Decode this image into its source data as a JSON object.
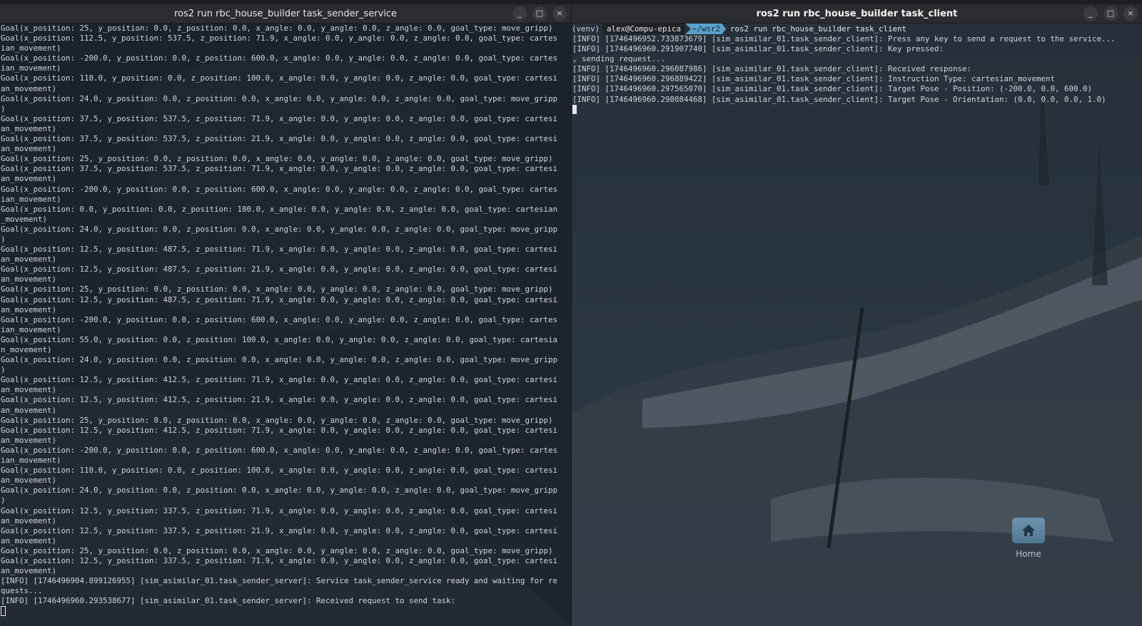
{
  "left_window": {
    "title": "ros2 run rbc_house_builder task_sender_service",
    "lines": [
      "Goal(x_position: 25, y_position: 0.0, z_position: 0.0, x_angle: 0.0, y_angle: 0.0, z_angle: 0.0, goal_type: move_gripp)",
      "Goal(x_position: 112.5, y_position: 537.5, z_position: 71.9, x_angle: 0.0, y_angle: 0.0, z_angle: 0.0, goal_type: cartes",
      "ian_movement)",
      "Goal(x_position: -200.0, y_position: 0.0, z_position: 600.0, x_angle: 0.0, y_angle: 0.0, z_angle: 0.0, goal_type: cartes",
      "ian_movement)",
      "Goal(x_position: 110.0, y_position: 0.0, z_position: 100.0, x_angle: 0.0, y_angle: 0.0, z_angle: 0.0, goal_type: cartesi",
      "an_movement)",
      "Goal(x_position: 24.0, y_position: 0.0, z_position: 0.0, x_angle: 0.0, y_angle: 0.0, z_angle: 0.0, goal_type: move_gripp",
      ")",
      "Goal(x_position: 37.5, y_position: 537.5, z_position: 71.9, x_angle: 0.0, y_angle: 0.0, z_angle: 0.0, goal_type: cartesi",
      "an_movement)",
      "Goal(x_position: 37.5, y_position: 537.5, z_position: 21.9, x_angle: 0.0, y_angle: 0.0, z_angle: 0.0, goal_type: cartesi",
      "an_movement)",
      "Goal(x_position: 25, y_position: 0.0, z_position: 0.0, x_angle: 0.0, y_angle: 0.0, z_angle: 0.0, goal_type: move_gripp)",
      "Goal(x_position: 37.5, y_position: 537.5, z_position: 71.9, x_angle: 0.0, y_angle: 0.0, z_angle: 0.0, goal_type: cartesi",
      "an_movement)",
      "Goal(x_position: -200.0, y_position: 0.0, z_position: 600.0, x_angle: 0.0, y_angle: 0.0, z_angle: 0.0, goal_type: cartes",
      "ian_movement)",
      "Goal(x_position: 0.0, y_position: 0.0, z_position: 100.0, x_angle: 0.0, y_angle: 0.0, z_angle: 0.0, goal_type: cartesian",
      "_movement)",
      "Goal(x_position: 24.0, y_position: 0.0, z_position: 0.0, x_angle: 0.0, y_angle: 0.0, z_angle: 0.0, goal_type: move_gripp",
      ")",
      "Goal(x_position: 12.5, y_position: 487.5, z_position: 71.9, x_angle: 0.0, y_angle: 0.0, z_angle: 0.0, goal_type: cartesi",
      "an_movement)",
      "Goal(x_position: 12.5, y_position: 487.5, z_position: 21.9, x_angle: 0.0, y_angle: 0.0, z_angle: 0.0, goal_type: cartesi",
      "an_movement)",
      "Goal(x_position: 25, y_position: 0.0, z_position: 0.0, x_angle: 0.0, y_angle: 0.0, z_angle: 0.0, goal_type: move_gripp)",
      "Goal(x_position: 12.5, y_position: 487.5, z_position: 71.9, x_angle: 0.0, y_angle: 0.0, z_angle: 0.0, goal_type: cartesi",
      "an_movement)",
      "Goal(x_position: -200.0, y_position: 0.0, z_position: 600.0, x_angle: 0.0, y_angle: 0.0, z_angle: 0.0, goal_type: cartes",
      "ian_movement)",
      "Goal(x_position: 55.0, y_position: 0.0, z_position: 100.0, x_angle: 0.0, y_angle: 0.0, z_angle: 0.0, goal_type: cartesia",
      "n_movement)",
      "Goal(x_position: 24.0, y_position: 0.0, z_position: 0.0, x_angle: 0.0, y_angle: 0.0, z_angle: 0.0, goal_type: move_gripp",
      ")",
      "Goal(x_position: 12.5, y_position: 412.5, z_position: 71.9, x_angle: 0.0, y_angle: 0.0, z_angle: 0.0, goal_type: cartesi",
      "an_movement)",
      "Goal(x_position: 12.5, y_position: 412.5, z_position: 21.9, x_angle: 0.0, y_angle: 0.0, z_angle: 0.0, goal_type: cartesi",
      "an_movement)",
      "Goal(x_position: 25, y_position: 0.0, z_position: 0.0, x_angle: 0.0, y_angle: 0.0, z_angle: 0.0, goal_type: move_gripp)",
      "Goal(x_position: 12.5, y_position: 412.5, z_position: 71.9, x_angle: 0.0, y_angle: 0.0, z_angle: 0.0, goal_type: cartesi",
      "an_movement)",
      "Goal(x_position: -200.0, y_position: 0.0, z_position: 600.0, x_angle: 0.0, y_angle: 0.0, z_angle: 0.0, goal_type: cartes",
      "ian_movement)",
      "Goal(x_position: 110.0, y_position: 0.0, z_position: 100.0, x_angle: 0.0, y_angle: 0.0, z_angle: 0.0, goal_type: cartesi",
      "an_movement)",
      "Goal(x_position: 24.0, y_position: 0.0, z_position: 0.0, x_angle: 0.0, y_angle: 0.0, z_angle: 0.0, goal_type: move_gripp",
      ")",
      "Goal(x_position: 12.5, y_position: 337.5, z_position: 71.9, x_angle: 0.0, y_angle: 0.0, z_angle: 0.0, goal_type: cartesi",
      "an_movement)",
      "Goal(x_position: 12.5, y_position: 337.5, z_position: 21.9, x_angle: 0.0, y_angle: 0.0, z_angle: 0.0, goal_type: cartesi",
      "an_movement)",
      "Goal(x_position: 25, y_position: 0.0, z_position: 0.0, x_angle: 0.0, y_angle: 0.0, z_angle: 0.0, goal_type: move_gripp)",
      "Goal(x_position: 12.5, y_position: 337.5, z_position: 71.9, x_angle: 0.0, y_angle: 0.0, z_angle: 0.0, goal_type: cartesi",
      "an_movement)",
      "[INFO] [1746496904.899126955] [sim_asimilar_01.task_sender_server]: Service task_sender_service ready and waiting for re",
      "quests...",
      "[INFO] [1746496960.293538677] [sim_asimilar_01.task_sender_server]: Received request to send task:"
    ]
  },
  "right_window": {
    "title": "ros2 run rbc_house_builder task_client",
    "prompt": {
      "venv": "(venv)",
      "user": "alex@Compu-epica",
      "dir": "~/wsr2",
      "command": "ros2 run rbc_house_builder task_client"
    },
    "lines": [
      "[INFO] [1746496952.733873679] [sim_asimilar_01.task_sender_client]: Press any key to send a request to the service...",
      "[INFO] [1746496960.291907740] [sim_asimilar_01.task_sender_client]: Key pressed:",
      ", sending request...",
      "[INFO] [1746496960.296087986] [sim_asimilar_01.task_sender_client]: Received response:",
      "[INFO] [1746496960.296889422] [sim_asimilar_01.task_sender_client]: Instruction Type: cartesian_movement",
      "[INFO] [1746496960.297565070] [sim_asimilar_01.task_sender_client]: Target Pose - Position: (-200.0, 0.0, 600.0)",
      "[INFO] [1746496960.298084468] [sim_asimilar_01.task_sender_client]: Target Pose - Orientation: (0.0, 0.0, 0.0, 1.0)"
    ]
  },
  "window_controls": {
    "minimize": "_",
    "maximize": "□",
    "close": "×"
  },
  "desktop": {
    "home_label": "Home",
    "home_icon": "home-icon"
  }
}
